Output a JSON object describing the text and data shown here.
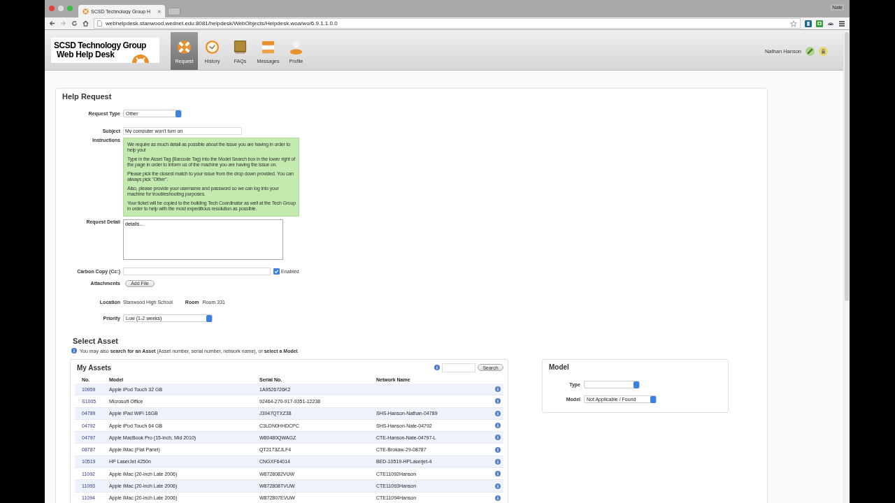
{
  "browser": {
    "tab_title": "SCSD Technology Group H",
    "profile": "Nate",
    "url": "webhelpdesk.stanwood.wednet.edu:8081/helpdesk/WebObjects/Helpdesk.woa/wo/6.9.1.1.0.0"
  },
  "header": {
    "logo_lines": [
      "SCSD Technology Group",
      "Web Help Desk"
    ],
    "nav": [
      {
        "label": "Request",
        "kind": "request",
        "selected": true
      },
      {
        "label": "History",
        "kind": "history",
        "selected": false
      },
      {
        "label": "FAQs",
        "kind": "faqs",
        "selected": false
      },
      {
        "label": "Messages",
        "kind": "messages",
        "selected": false
      },
      {
        "label": "Profile",
        "kind": "profile",
        "selected": false
      }
    ],
    "user": "Nathan Hanson"
  },
  "help_request": {
    "title": "Help Request",
    "request_type": {
      "label": "Request Type",
      "value": "Other"
    },
    "subject": {
      "label": "Subject",
      "value": "My computer won't turn on"
    },
    "instructions": {
      "label": "Instructions",
      "paragraphs": [
        "We require as much detail as possible about the issue you are having in order to help you!",
        "Type in the Asset Tag (Barcode Tag) into the Model Search box in the lower right of the page in order to inform us of the machine you are having the issue on.",
        "Please pick the closest match to your issue from the drop down provided. You can always pick \"Other\".",
        "Also, please provide your username and password so we can log into your machine for troubleshooting purposes.",
        "Your ticket will be copied to the building Tech Coordinator as well at the Tech Group in order to help with the most expeditious resolution as possible."
      ]
    },
    "request_detail": {
      "label": "Request Detail",
      "value": "details..."
    },
    "carbon_copy": {
      "label": "Carbon Copy (Cc:)",
      "checkbox_label": "Enabled",
      "checked": true
    },
    "attachments": {
      "label": "Attachments",
      "button": "Add File"
    },
    "location": {
      "label": "Location",
      "value": "Stanwood High School",
      "room_label": "Room",
      "room": "Room 331"
    },
    "priority": {
      "label": "Priority",
      "value": "Low (1-2 weeks)"
    }
  },
  "select_asset": {
    "title": "Select Asset",
    "note": "You may also **search for an Asset** (Asset number, serial number, network name), or **select a Model**."
  },
  "my_assets": {
    "title": "My Assets",
    "search_button": "Search",
    "columns": [
      "No.",
      "Model",
      "Serial No.",
      "Network Name"
    ],
    "rows": [
      {
        "no": "10959",
        "model": "Apple iPod Touch 32 GB",
        "serial": "1A9526726K2",
        "network": ""
      },
      {
        "no": "S1005",
        "model": "Microsoft Office",
        "serial": "92464-270-917-9351-12238",
        "network": ""
      },
      {
        "no": "04789",
        "model": "Apple iPad WiFi 16GB",
        "serial": "J3047QTXZ38",
        "network": "SHS-Hanson-Nathan-04789"
      },
      {
        "no": "04792",
        "model": "Apple iPod Touch 64 GB",
        "serial": "C3LDN0HHDCPC",
        "network": "SHS-Hanson-Nate-04792"
      },
      {
        "no": "04797",
        "model": "Apple MacBook Pro (15-inch, Mid 2010)",
        "serial": "W80480QWAGZ",
        "network": "CTE-Hanson-Nate-04797-L"
      },
      {
        "no": "08787",
        "model": "Apple iMac (Flat Panel)",
        "serial": "QT2173ZJLF4",
        "network": "CTE-Brokaw-29-08787"
      },
      {
        "no": "10519",
        "model": "HP LaserJet 4250n",
        "serial": "CNGXF64014",
        "network": "BED-10519-HPLaserjet-4"
      },
      {
        "no": "11092",
        "model": "Apple iMac (20-inch Late 2006)",
        "serial": "W8728082VUW",
        "network": "CTE11092Hanson"
      },
      {
        "no": "11093",
        "model": "Apple iMac (20-inch Late 2006)",
        "serial": "W872808TVUW",
        "network": "CTE11093Hanson"
      },
      {
        "no": "11094",
        "model": "Apple iMac (20-inch Late 2006)",
        "serial": "W872807EVUW",
        "network": "CTE11094Hanson"
      }
    ]
  },
  "model_panel": {
    "title": "Model",
    "type_label": "Type",
    "model_label": "Model",
    "model_value": "Not Applicable / Found"
  }
}
